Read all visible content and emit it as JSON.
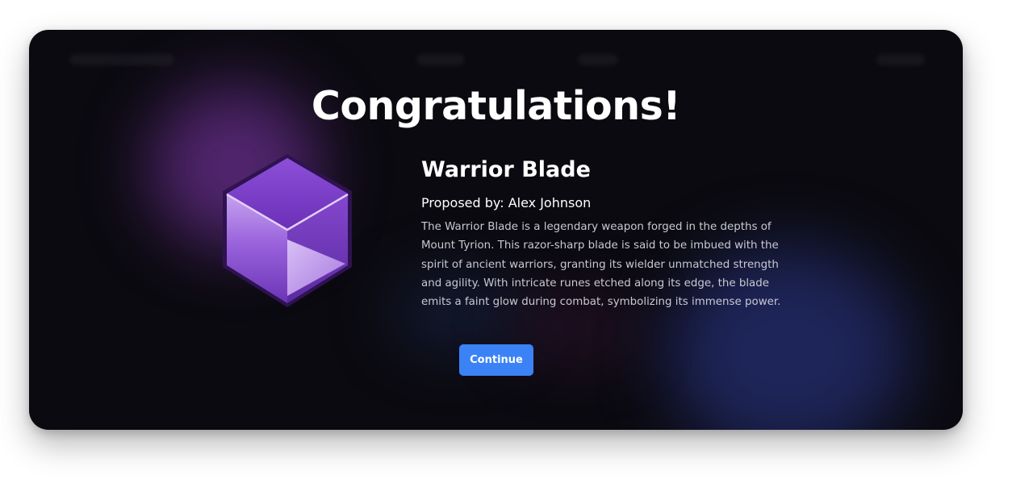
{
  "modal": {
    "title": "Congratulations!",
    "item": {
      "name": "Warrior Blade",
      "proposed_by": "Proposed by: Alex Johnson",
      "description": "The Warrior Blade is a legendary weapon forged in the depths of Mount Tyrion. This razor-sharp blade is said to be imbued with the spirit of ancient warriors, granting its wielder unmatched strength and agility. With intricate runes etched along its edge, the blade emits a faint glow during combat, symbolizing its immense power.",
      "icon": "purple-cube-icon"
    },
    "continue_label": "Continue"
  },
  "colors": {
    "background": "#0b0a10",
    "accent_button": "#3b82f6",
    "cube_purple": "#8b45d6"
  }
}
